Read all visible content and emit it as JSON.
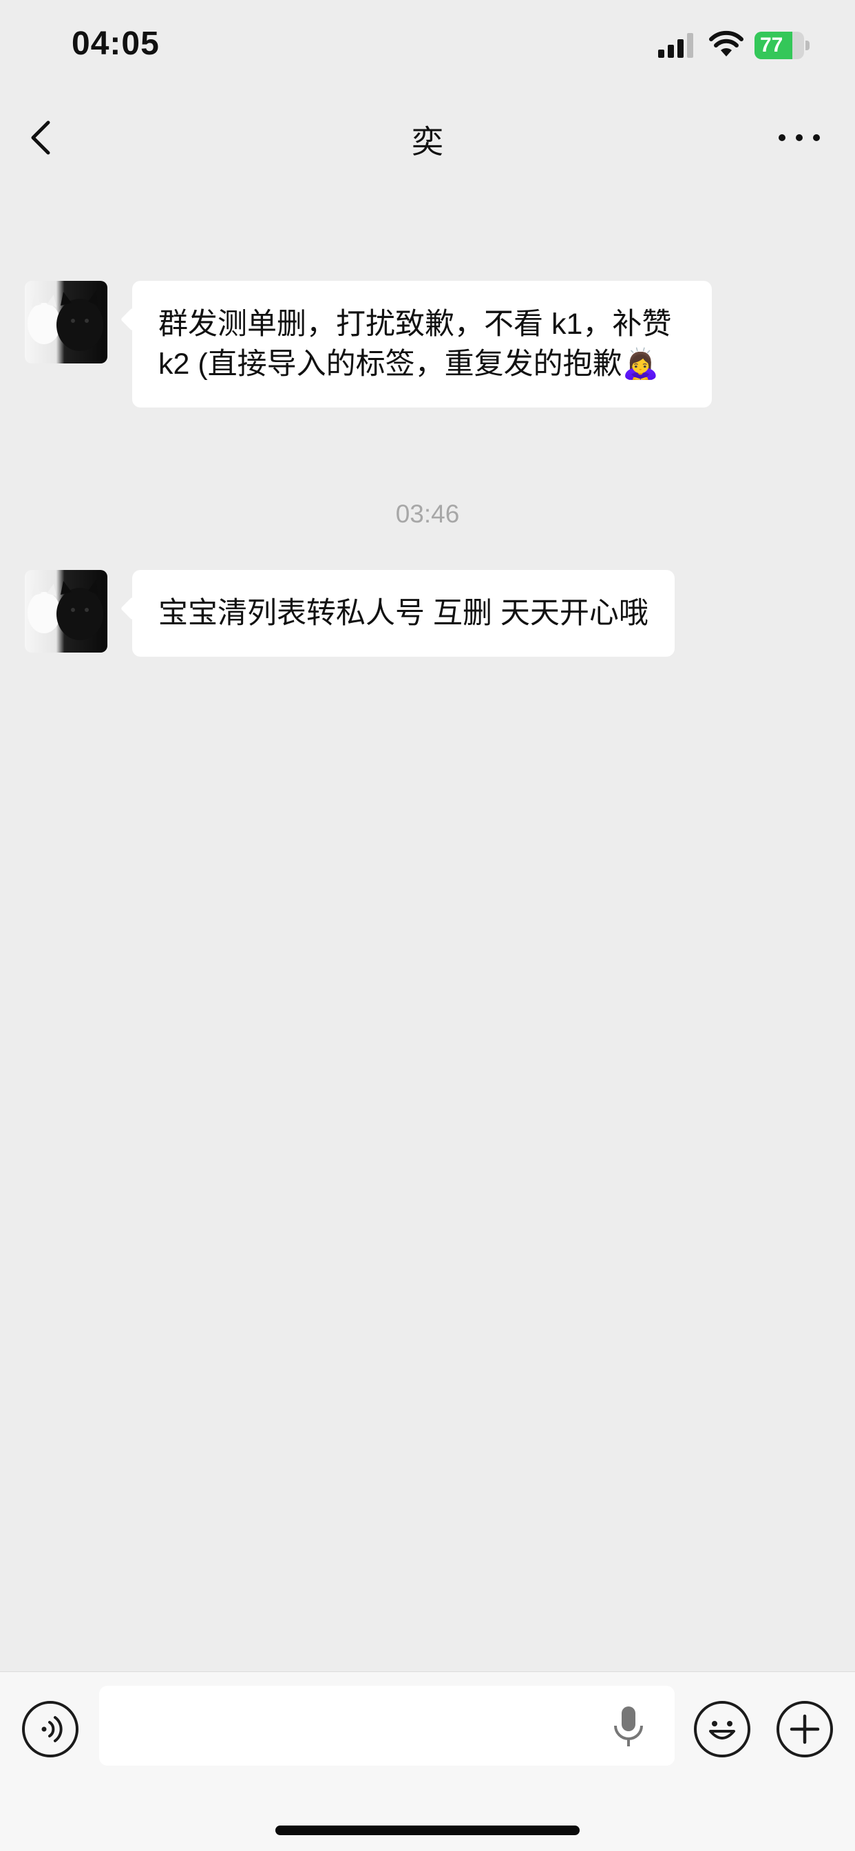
{
  "status_bar": {
    "time": "04:05",
    "battery_percent": 77,
    "battery_label": "77",
    "battery_color": "#34c759"
  },
  "nav": {
    "title": "奕",
    "back_icon": "chevron-left-icon",
    "more_icon": "more-dots-icon"
  },
  "messages": [
    {
      "sender": "other",
      "text": "群发测单删，打扰致歉，不看 k1，补赞 k2 (直接导入的标签，重复发的抱歉🙇‍♀️"
    },
    {
      "sender": "other",
      "text": "宝宝清列表转私人号 互删 天天开心哦"
    }
  ],
  "timestamp": "03:46",
  "input_bar": {
    "voice_icon": "voice-icon",
    "mic_icon": "microphone-icon",
    "emoji_icon": "emoji-icon",
    "plus_icon": "plus-icon",
    "input_value": ""
  },
  "colors": {
    "background": "#ededed",
    "bubble": "#ffffff",
    "timestamp": "#a7a7a7"
  }
}
